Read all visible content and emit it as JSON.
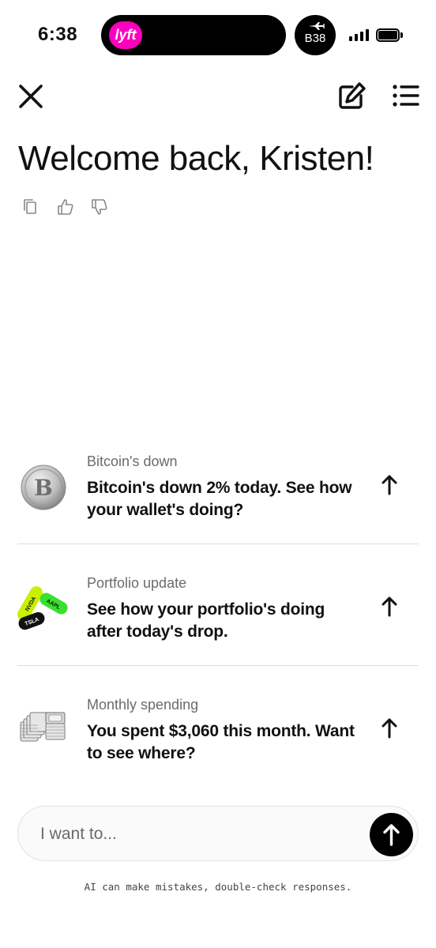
{
  "status_bar": {
    "time": "6:38",
    "live_activity_brand": "lyft",
    "live_activity_brand_color": "#ff00bf",
    "gate_label": "B38",
    "gate_icon": "airplane-icon"
  },
  "nav": {
    "close_icon": "close-icon",
    "new_chat_icon": "edit-icon",
    "menu_icon": "list-icon"
  },
  "header": {
    "welcome": "Welcome back, Kristen!"
  },
  "feedback": {
    "icons": [
      "copy-icon",
      "thumbs-up-icon",
      "thumbs-down-icon"
    ]
  },
  "suggestions": [
    {
      "title": "Bitcoin's down",
      "text": "Bitcoin's down 2% today. See how your wallet's doing?",
      "thumbnail": "bitcoin-coin-icon"
    },
    {
      "title": "Portfolio update",
      "text": "See how your portfolio's doing after today's drop.",
      "thumbnail": "stock-pills-icon",
      "tickers": [
        "NVDA",
        "AAPL",
        "TSLA"
      ]
    },
    {
      "title": "Monthly spending",
      "text": "You spent $3,060 this month. Want to see where?",
      "thumbnail": "cash-stack-icon"
    }
  ],
  "composer": {
    "placeholder": "I want to..."
  },
  "footer": {
    "disclaimer": "AI can make mistakes, double-check responses."
  }
}
